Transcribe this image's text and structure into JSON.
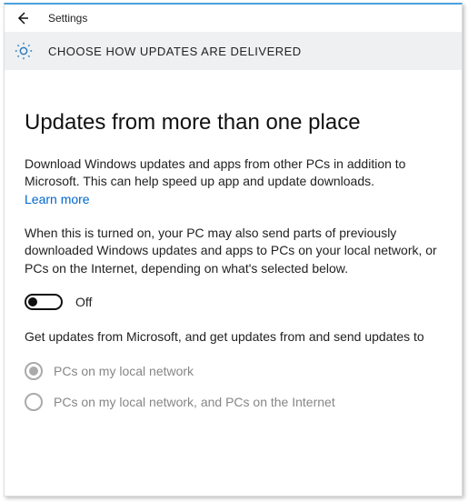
{
  "window": {
    "title": "Settings"
  },
  "header": {
    "section_title": "CHOOSE HOW UPDATES ARE DELIVERED"
  },
  "main": {
    "heading": "Updates from more than one place",
    "paragraph1_part1": "Download Windows updates and apps from other PCs in addition to Microsoft. This can help speed up app and update downloads. ",
    "learn_more": "Learn more",
    "paragraph2": "When this is turned on, your PC may also send parts of previously downloaded Windows updates and apps to PCs on your local network, or PCs on the Internet, depending on what's selected below.",
    "toggle": {
      "state_label": "Off",
      "value": false
    },
    "paragraph3": "Get updates from Microsoft, and get updates from and send updates to",
    "options": [
      {
        "label": "PCs on my local network",
        "selected": true
      },
      {
        "label": "PCs on my local network, and PCs on the Internet",
        "selected": false
      }
    ]
  }
}
